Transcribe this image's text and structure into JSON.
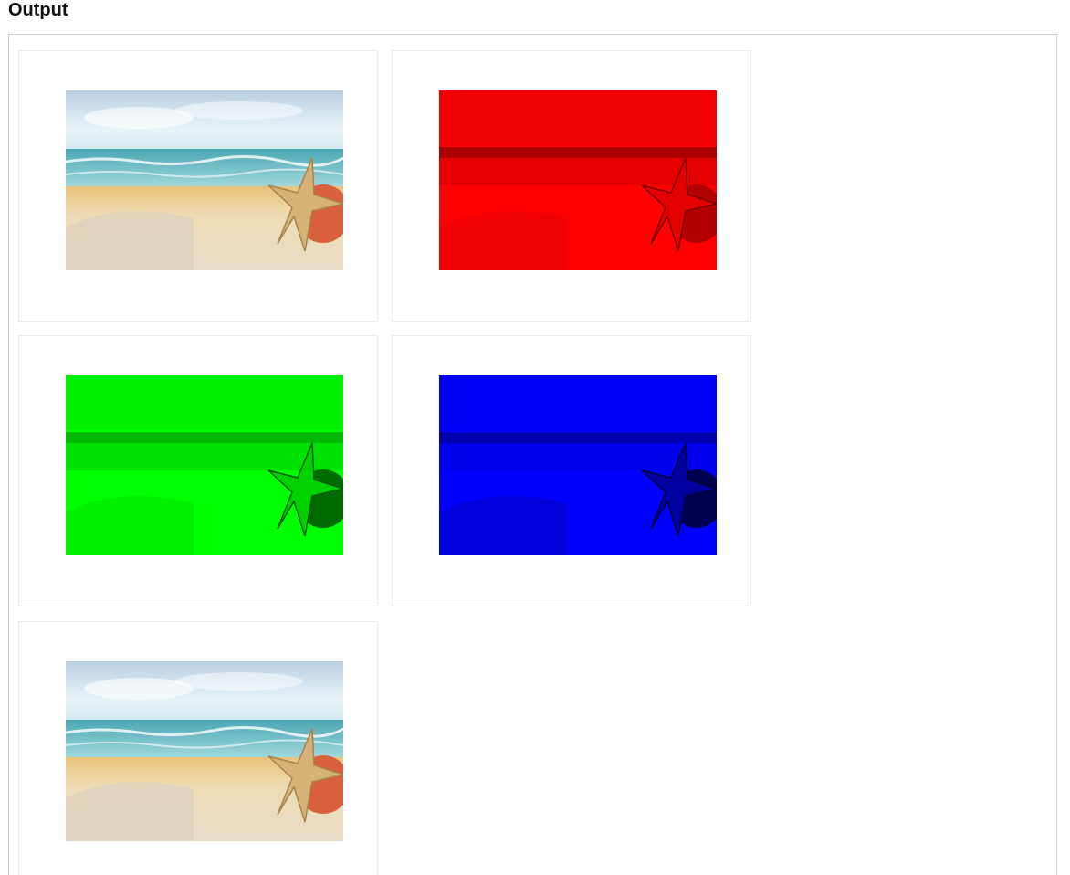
{
  "heading": "Output",
  "cards": [
    {
      "variant": "original",
      "tint": "none"
    },
    {
      "variant": "red-channel",
      "tint": "#ff0000"
    },
    {
      "variant": "green-channel",
      "tint": "#00ff00"
    },
    {
      "variant": "blue-channel",
      "tint": "#0000ff"
    },
    {
      "variant": "original",
      "tint": "none"
    }
  ],
  "icons": {
    "photo": "beach-starfish-photo"
  }
}
